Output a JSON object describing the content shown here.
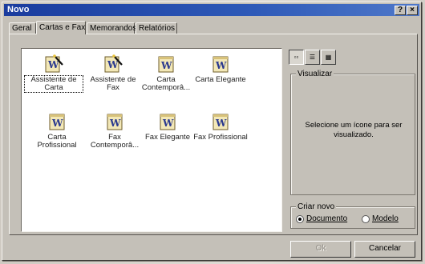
{
  "window": {
    "title": "Novo",
    "help_glyph": "?",
    "close_glyph": "×"
  },
  "tabs": [
    {
      "label": "Geral"
    },
    {
      "label": "Cartas e Fax",
      "active": true
    },
    {
      "label": "Memorandos"
    },
    {
      "label": "Relatórios"
    }
  ],
  "templates": [
    {
      "label": "Assistente de Carta",
      "selected": true,
      "icon": "wizard-document-icon"
    },
    {
      "label": "Assistente de Fax",
      "icon": "wizard-document-icon"
    },
    {
      "label": "Carta Contemporâ...",
      "icon": "word-document-icon"
    },
    {
      "label": "Carta Elegante",
      "icon": "word-document-icon"
    },
    {
      "label": "Carta Profissional",
      "icon": "word-document-icon"
    },
    {
      "label": "Fax Contemporâ...",
      "icon": "word-document-icon"
    },
    {
      "label": "Fax Elegante",
      "icon": "word-document-icon"
    },
    {
      "label": "Fax Profissional",
      "icon": "word-document-icon"
    }
  ],
  "view_buttons": [
    {
      "name": "large-icons-view",
      "glyph": "▫▫",
      "pressed": true
    },
    {
      "name": "list-view",
      "glyph": "☰"
    },
    {
      "name": "details-view",
      "glyph": "▦"
    }
  ],
  "preview": {
    "label": "Visualizar",
    "text": "Selecione um ícone para ser visualizado."
  },
  "create_new": {
    "label": "Criar novo",
    "options": [
      {
        "label": "Documento",
        "checked": true
      },
      {
        "label": "Modelo",
        "checked": false
      }
    ]
  },
  "buttons": {
    "ok": "Ok",
    "cancel": "Cancelar"
  },
  "colors": {
    "titlebar": "#1a3c9e",
    "dialog_face": "#c4c0b8",
    "icon_accent": "#2b3a8f",
    "icon_doc": "#f3e8b7"
  }
}
